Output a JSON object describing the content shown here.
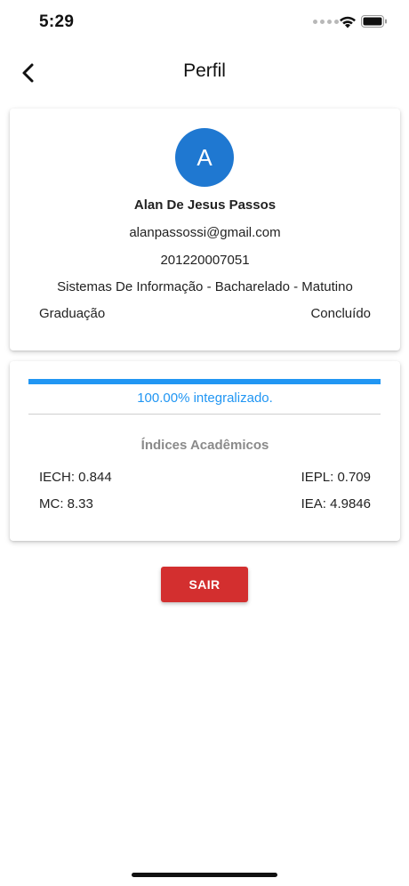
{
  "status_bar": {
    "time": "5:29",
    "icons": [
      "wifi-icon",
      "battery-icon"
    ]
  },
  "header": {
    "title": "Perfil",
    "back_icon": "chevron-left-icon"
  },
  "profile": {
    "avatar_initial": "A",
    "avatar_color": "#1f78d1",
    "name": "Alan De Jesus Passos",
    "email": "alanpassossi@gmail.com",
    "registration": "201220007051",
    "course": "Sistemas De Informação - Bacharelado - Matutino",
    "level": "Graduação",
    "status": "Concluído"
  },
  "progress": {
    "percent": 100,
    "label": "100.00% integralizado.",
    "color": "#2196f3"
  },
  "indices": {
    "title": "Índices Acadêmicos",
    "iech": "IECH: 0.844",
    "iepl": "IEPL: 0.709",
    "mc": "MC: 8.33",
    "iea": "IEA: 4.9846"
  },
  "actions": {
    "logout_label": "SAIR",
    "logout_color": "#d32f2f"
  }
}
